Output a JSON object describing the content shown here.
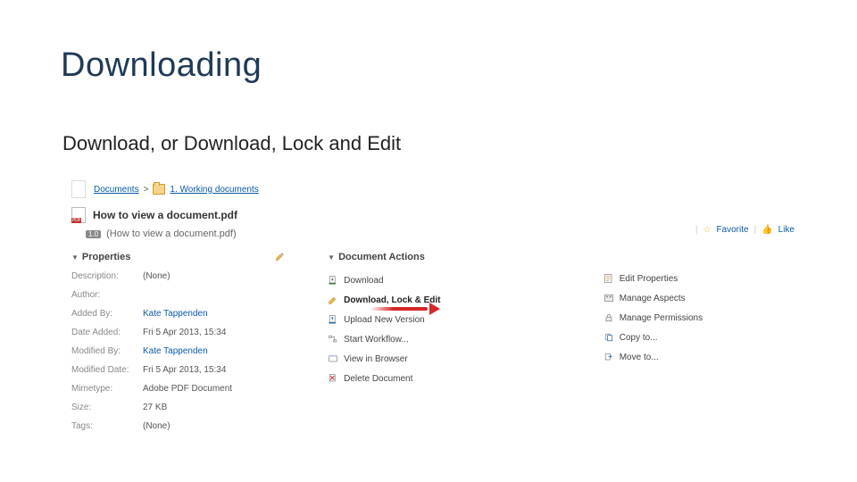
{
  "slide": {
    "title": "Downloading",
    "subtitle": "Download, or Download, Lock and Edit"
  },
  "breadcrumb": {
    "root": "Documents",
    "sep": ">",
    "folder": "1. Working documents"
  },
  "doc": {
    "title": "How to view a document.pdf",
    "version_badge": "1.0",
    "filename_paren": "(How to view a document.pdf)"
  },
  "top_links": {
    "favorite": "Favorite",
    "like": "Like"
  },
  "properties": {
    "header": "Properties",
    "rows": {
      "description_label": "Description:",
      "description_value": "(None)",
      "author_label": "Author:",
      "author_value": "",
      "added_by_label": "Added By:",
      "added_by_value": "Kate Tappenden",
      "date_added_label": "Date Added:",
      "date_added_value": "Fri 5 Apr 2013, 15:34",
      "modified_by_label": "Modified By:",
      "modified_by_value": "Kate Tappenden",
      "modified_date_label": "Modified Date:",
      "modified_date_value": "Fri 5 Apr 2013, 15:34",
      "mimetype_label": "Mimetype:",
      "mimetype_value": "Adobe PDF Document",
      "size_label": "Size:",
      "size_value": "27 KB",
      "tags_label": "Tags:",
      "tags_value": "(None)"
    }
  },
  "document_actions": {
    "header": "Document Actions",
    "items": {
      "download": "Download",
      "download_lock_edit": "Download, Lock & Edit",
      "upload_new_version": "Upload New Version",
      "start_workflow": "Start Workflow...",
      "view_in_browser": "View in Browser",
      "delete_document": "Delete Document"
    }
  },
  "right_actions": {
    "items": {
      "edit_properties": "Edit Properties",
      "manage_aspects": "Manage Aspects",
      "manage_permissions": "Manage Permissions",
      "copy_to": "Copy to...",
      "move_to": "Move to..."
    }
  }
}
